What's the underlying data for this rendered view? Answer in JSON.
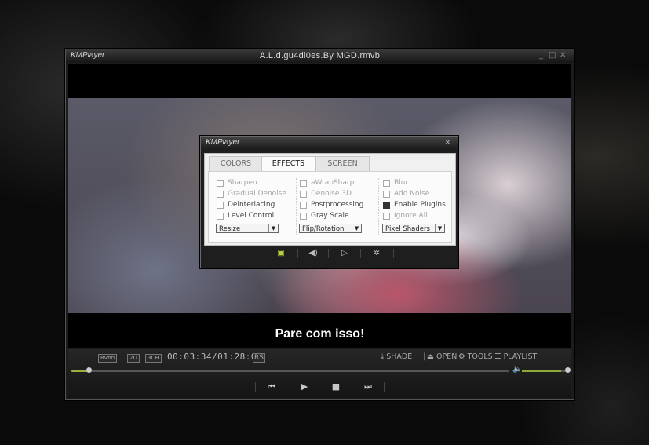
{
  "window": {
    "logo": "KMPlayer",
    "title": "A.L.d.gu4di0es.By MGD.rmvb",
    "minimize": "_",
    "maximize": "□",
    "close": "✕"
  },
  "video": {
    "subtitle": "Pare com isso!"
  },
  "controls": {
    "tags": [
      "RVnn",
      "2D",
      "3CH"
    ],
    "time": "00:03:34/01:28:08",
    "rs": "RS",
    "shade": "SHADE",
    "open": "OPEN",
    "tools": "TOOLS",
    "playlist": "PLAYLIST",
    "seek_progress": 0.04,
    "volume_level": 0.9
  },
  "dialog": {
    "logo": "KMPlayer",
    "close": "✕",
    "tabs": [
      "COLORS",
      "EFFECTS",
      "SCREEN"
    ],
    "active_tab": "EFFECTS",
    "col1": [
      "Sharpen",
      "Gradual Denoise",
      "Deinterlacing",
      "Level Control"
    ],
    "col2": [
      "aWrapSharp",
      "Denoise 3D",
      "Postprocessing",
      "Gray Scale"
    ],
    "col3": [
      "Blur",
      "Add Noise",
      "Enable Plugins",
      "Ignore All"
    ],
    "select1": "Resize",
    "select2": "Flip/Rotation",
    "select3": "Pixel Shaders"
  },
  "colors": {
    "accent": "#9ab13e",
    "dialog_active_icon": "#b8d040"
  }
}
